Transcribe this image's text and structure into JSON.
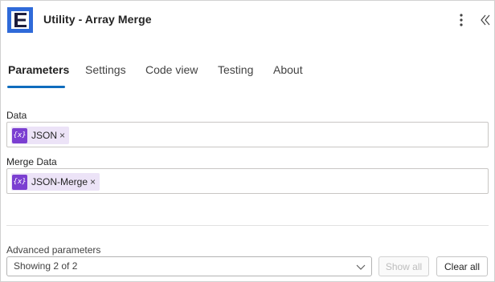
{
  "header": {
    "title": "Utility - Array Merge",
    "logo_icon": "utility-logo-icon",
    "more_icon": "more-vertical-icon",
    "collapse_icon": "double-chevron-left-icon"
  },
  "tabs": [
    {
      "label": "Parameters",
      "active": true
    },
    {
      "label": "Settings",
      "active": false
    },
    {
      "label": "Code view",
      "active": false
    },
    {
      "label": "Testing",
      "active": false
    },
    {
      "label": "About",
      "active": false
    }
  ],
  "fields": [
    {
      "label": "Data",
      "token": {
        "icon": "expression-icon",
        "icon_text": "{x}",
        "text": "JSON",
        "close": "×"
      }
    },
    {
      "label": "Merge Data",
      "token": {
        "icon": "expression-icon",
        "icon_text": "{x}",
        "text": "JSON-Merge",
        "close": "×"
      }
    }
  ],
  "advanced": {
    "label": "Advanced parameters",
    "select_value": "Showing 2 of 2",
    "show_all_label": "Show all",
    "clear_all_label": "Clear all"
  },
  "colors": {
    "accent": "#0f6cbd",
    "logo_bg": "#2f6ad9",
    "token_bg": "#ece3f7",
    "token_icon_bg": "#7b3fd1"
  }
}
